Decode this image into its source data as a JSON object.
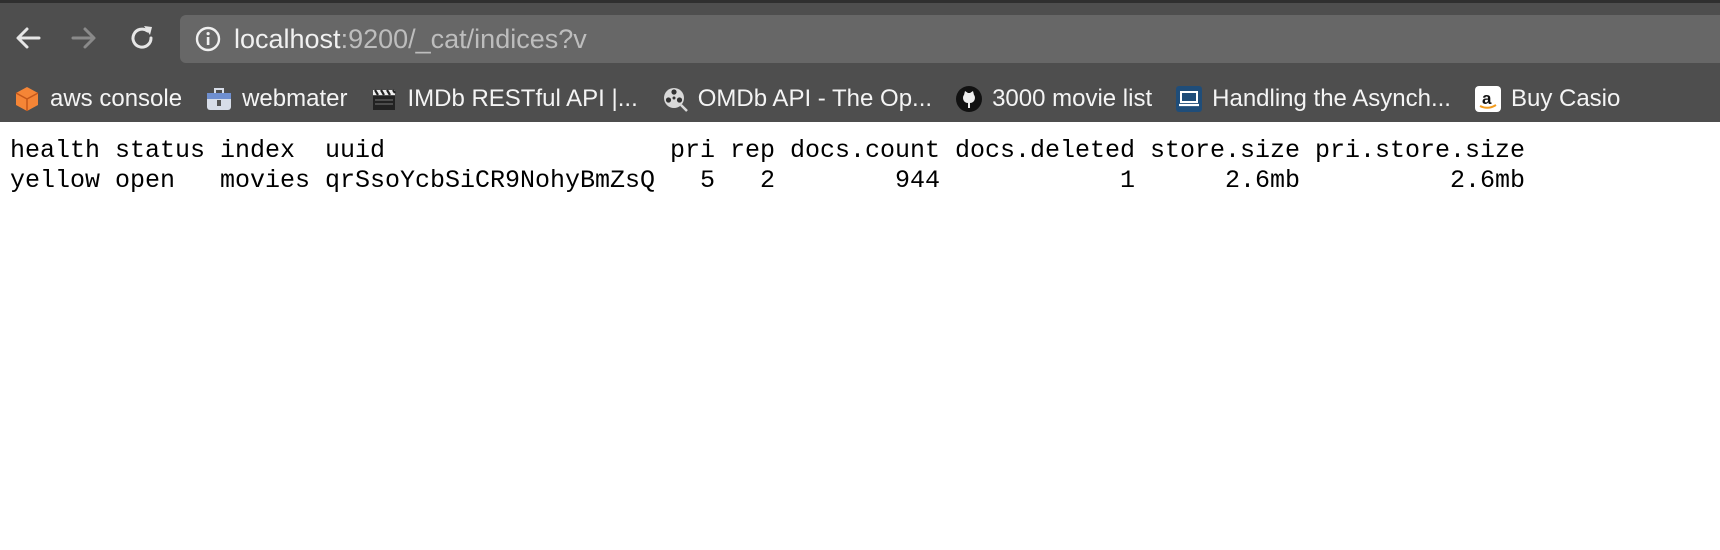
{
  "browser": {
    "url_host": "localhost",
    "url_rest": ":9200/_cat/indices?v",
    "bookmarks": [
      {
        "label": "aws console",
        "icon": "aws-cube-icon"
      },
      {
        "label": "webmater",
        "icon": "briefcase-icon"
      },
      {
        "label": "IMDb RESTful API |...",
        "icon": "clapperboard-icon"
      },
      {
        "label": "OMDb API - The Op...",
        "icon": "film-reel-icon"
      },
      {
        "label": "3000 movie list",
        "icon": "github-icon"
      },
      {
        "label": "Handling the Asynch...",
        "icon": "laptop-icon"
      },
      {
        "label": "Buy Casio",
        "icon": "amazon-icon"
      }
    ]
  },
  "table": {
    "headers": [
      "health",
      "status",
      "index",
      "uuid",
      "pri",
      "rep",
      "docs.count",
      "docs.deleted",
      "store.size",
      "pri.store.size"
    ],
    "rows": [
      [
        "yellow",
        "open",
        "movies",
        "qrSsoYcbSiCR9NohyBmZsQ",
        "5",
        "2",
        "944",
        "1",
        "2.6mb",
        "2.6mb"
      ]
    ]
  },
  "colors": {
    "chrome_bg": "#4e4e4e",
    "omnibox_bg": "#676767",
    "aws_orange": "#f58536"
  }
}
